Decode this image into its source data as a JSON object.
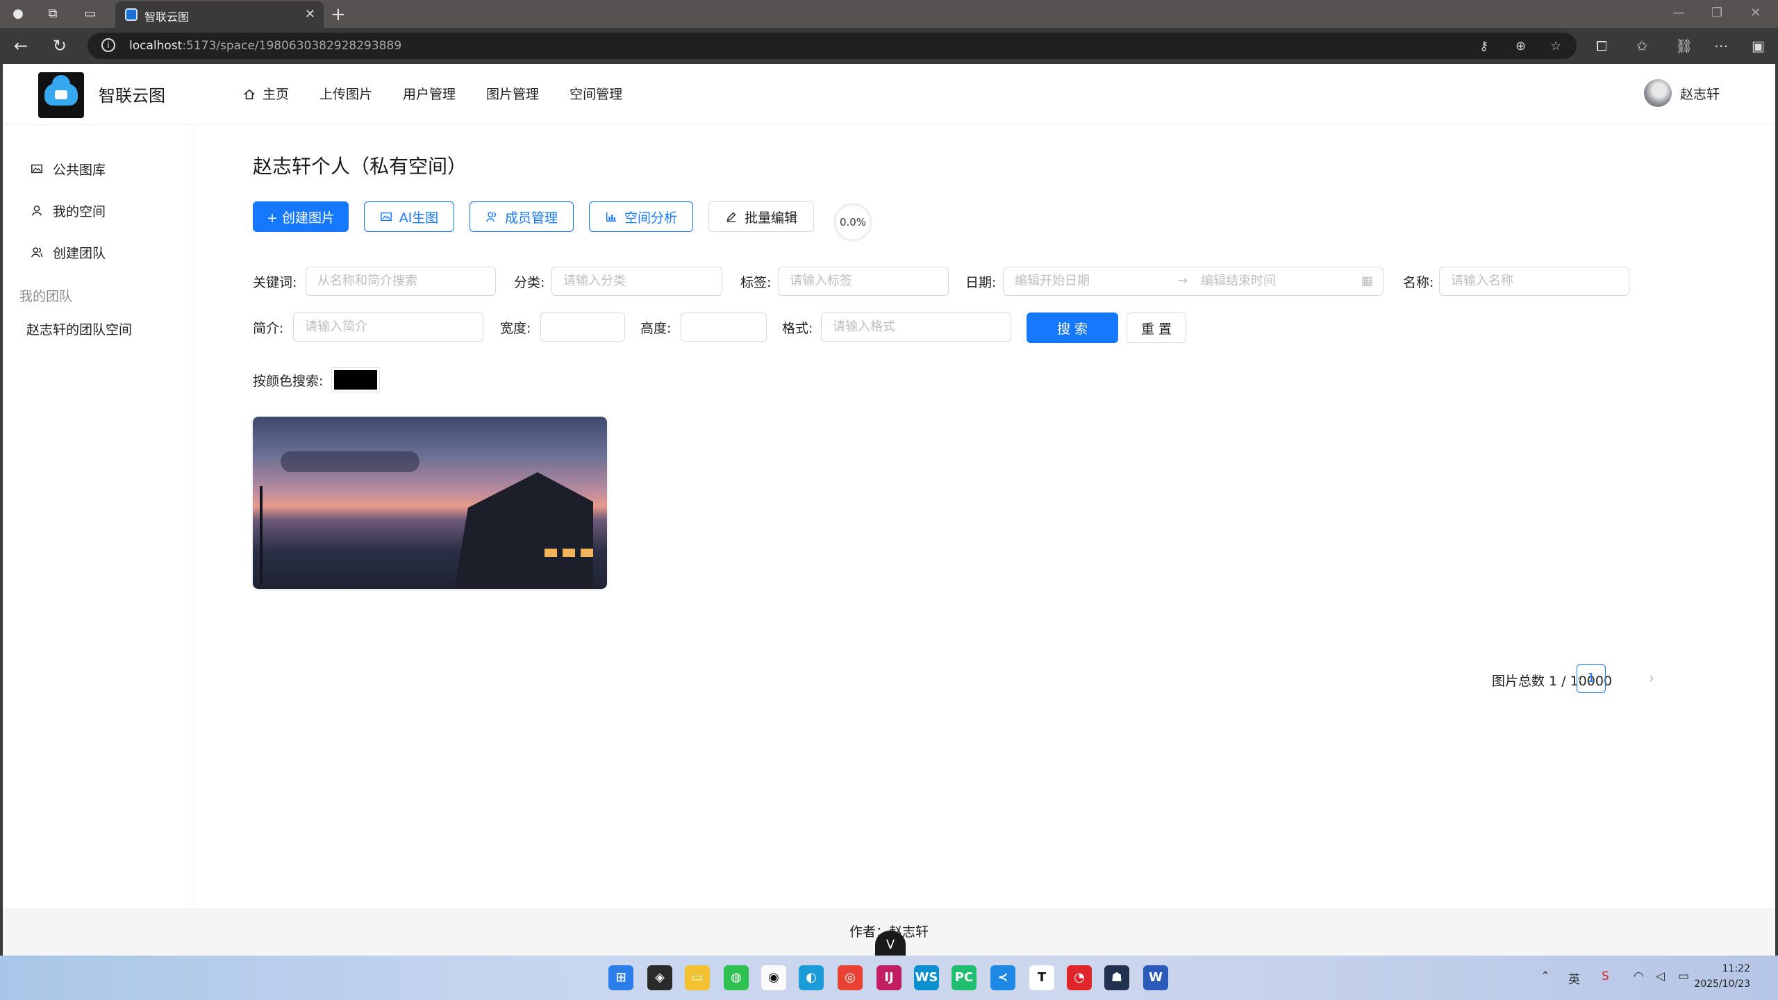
{
  "browser": {
    "tab_title": "智联云图",
    "url_host": "localhost",
    "url_path": ":5173/space/1980630382928293889"
  },
  "header": {
    "brand": "智联云图",
    "menu": [
      {
        "label": "主页",
        "icon": "home-icon"
      },
      {
        "label": "上传图片"
      },
      {
        "label": "用户管理"
      },
      {
        "label": "图片管理"
      },
      {
        "label": "空间管理"
      }
    ],
    "user_name": "赵志轩"
  },
  "sidebar": {
    "items": [
      {
        "label": "公共图库",
        "icon": "image-icon"
      },
      {
        "label": "我的空间",
        "icon": "user-icon"
      },
      {
        "label": "创建团队",
        "icon": "team-icon"
      }
    ],
    "group_label": "我的团队",
    "team_items": [
      {
        "label": "赵志轩的团队空间"
      }
    ]
  },
  "main": {
    "title": "赵志轩个人（私有空间）",
    "actions": {
      "create": "+ 创建图片",
      "ai": "AI生图",
      "members": "成员管理",
      "analysis": "空间分析",
      "batch_edit": "批量编辑"
    },
    "usage_percent": "0.0%",
    "filters": {
      "keyword_label": "关键词:",
      "keyword_placeholder": "从名称和简介搜索",
      "category_label": "分类:",
      "category_placeholder": "请输入分类",
      "tag_label": "标签:",
      "tag_placeholder": "请输入标签",
      "date_label": "日期:",
      "date_start_placeholder": "编辑开始日期",
      "date_end_placeholder": "编辑结束时间",
      "name_label": "名称:",
      "name_placeholder": "请输入名称",
      "intro_label": "简介:",
      "intro_placeholder": "请输入简介",
      "width_label": "宽度:",
      "height_label": "高度:",
      "format_label": "格式:",
      "format_placeholder": "请输入格式",
      "search_button": "搜 索",
      "reset_button": "重 置",
      "color_label": "按颜色搜索:",
      "color_value": "#000000"
    },
    "pagination": {
      "total_text": "图片总数 1 / 10000",
      "current_page": "1"
    }
  },
  "footer": {
    "text": "作者：赵志轩"
  },
  "taskbar": {
    "time": "11:22",
    "date": "2025/10/23"
  }
}
